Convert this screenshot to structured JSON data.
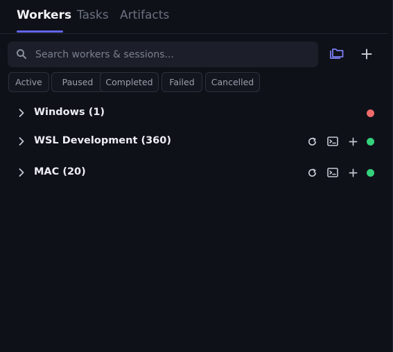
{
  "tabs": [
    {
      "label": "Workers",
      "active": true
    },
    {
      "label": "Tasks",
      "active": false
    },
    {
      "label": "Artifacts",
      "active": false
    }
  ],
  "search": {
    "placeholder": "Search workers & sessions..."
  },
  "toolbar": {
    "folder_icon": "folder-stack-icon",
    "add_icon": "plus-icon"
  },
  "filters": [
    "Active",
    "Paused",
    "Completed",
    "Failed",
    "Cancelled"
  ],
  "workers": [
    {
      "name": "Windows (1)",
      "status": "offline",
      "status_color": "#f06a6a",
      "actions": []
    },
    {
      "name": "WSL Development (360)",
      "status": "online",
      "status_color": "#34d27b",
      "actions": [
        "refresh-icon",
        "terminal-icon",
        "plus-icon"
      ]
    },
    {
      "name": "MAC (20)",
      "status": "online",
      "status_color": "#34d27b",
      "actions": [
        "refresh-icon",
        "terminal-icon",
        "plus-icon"
      ]
    }
  ],
  "colors": {
    "accent": "#6366f1",
    "background": "#0f1119",
    "online": "#34d27b",
    "offline": "#f06a6a"
  }
}
